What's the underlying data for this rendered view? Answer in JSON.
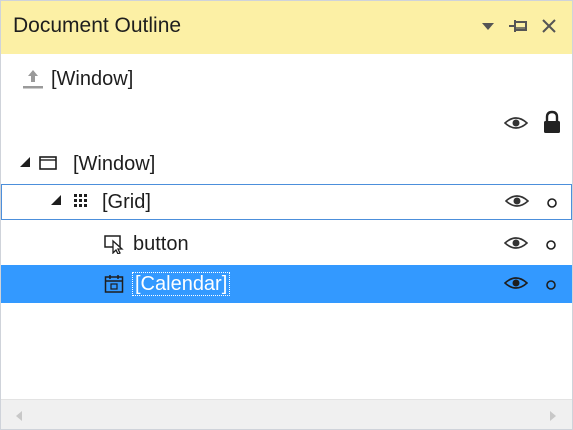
{
  "panel": {
    "title": "Document Outline",
    "colors": {
      "titlebar": "#fcf0a5",
      "selection": "#3399ff",
      "focus_border": "#4c8fdb"
    },
    "controls": [
      "dropdown-icon",
      "pin-icon",
      "close-icon"
    ]
  },
  "root": {
    "label": "[Window]",
    "icon": "up-arrow-icon"
  },
  "header_tools": {
    "visibility_icon": "eye-icon",
    "lock_icon": "lock-icon"
  },
  "tree": [
    {
      "label": "[Window]",
      "icon": "window-icon",
      "expanded": true,
      "level": 0,
      "show_tools": false
    },
    {
      "label": "[Grid]",
      "icon": "grid-icon",
      "expanded": true,
      "level": 1,
      "show_tools": true,
      "focused": true
    },
    {
      "label": "button",
      "icon": "button-icon",
      "level": 2,
      "show_tools": true
    },
    {
      "label": "[Calendar]",
      "icon": "calendar-icon",
      "level": 2,
      "show_tools": true,
      "selected": true
    }
  ]
}
